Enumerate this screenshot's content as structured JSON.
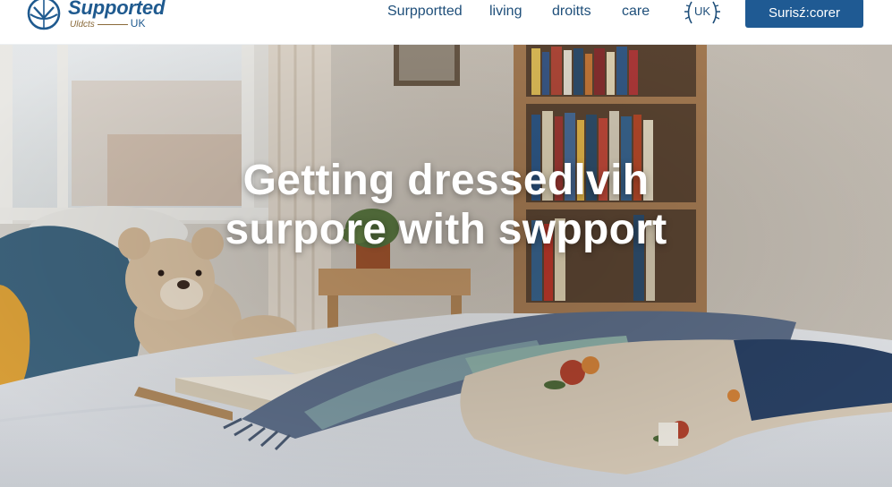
{
  "brand": {
    "name": "Supported",
    "tagline": "Uldcts",
    "region": "UK"
  },
  "nav": {
    "links": [
      "Surpportted",
      "living",
      "droitts",
      "care"
    ],
    "region_badge": "UK",
    "cta_label": "Surisź:corer"
  },
  "hero": {
    "title_line1": "Getting dressedlvih",
    "title_line2": "surpore with swpport"
  },
  "colors": {
    "brand_blue": "#1f5a93",
    "nav_text": "#1f4f7a",
    "hero_text": "#ffffff"
  },
  "icons": [
    "globe-logo-icon",
    "laurel-badge-icon"
  ]
}
